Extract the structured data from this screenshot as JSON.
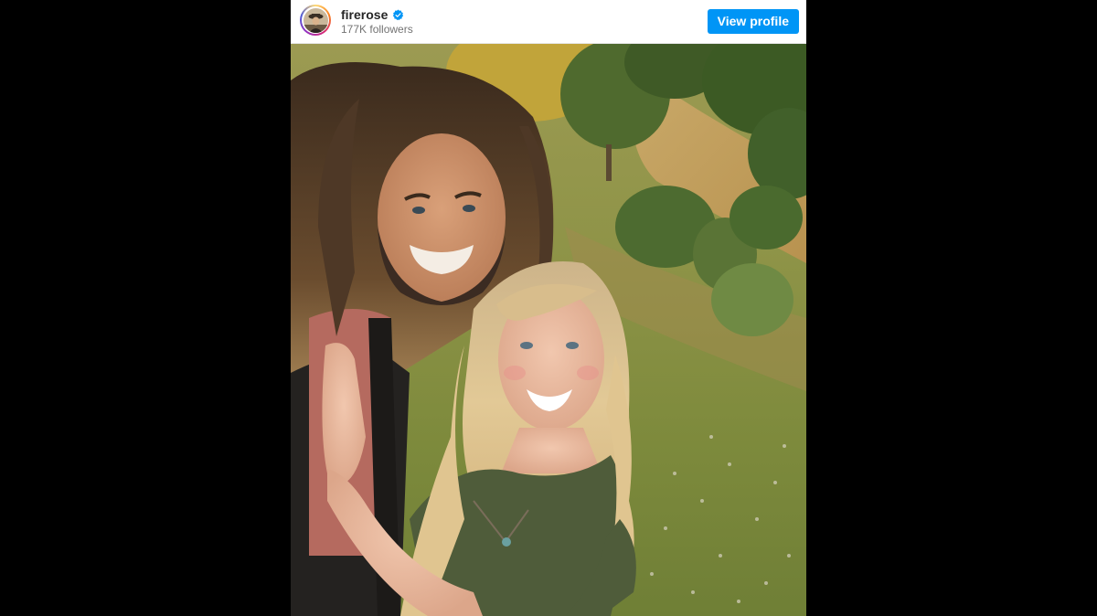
{
  "post": {
    "username": "firerose",
    "followers": "177K followers",
    "view_profile_label": "View profile",
    "avatar_icon": "avatar",
    "verified_icon": "verified-badge-icon"
  },
  "colors": {
    "accent": "#0095f6",
    "verified": "#0095f6",
    "username_text": "#262626",
    "muted_text": "#737373",
    "background": "#000000"
  }
}
